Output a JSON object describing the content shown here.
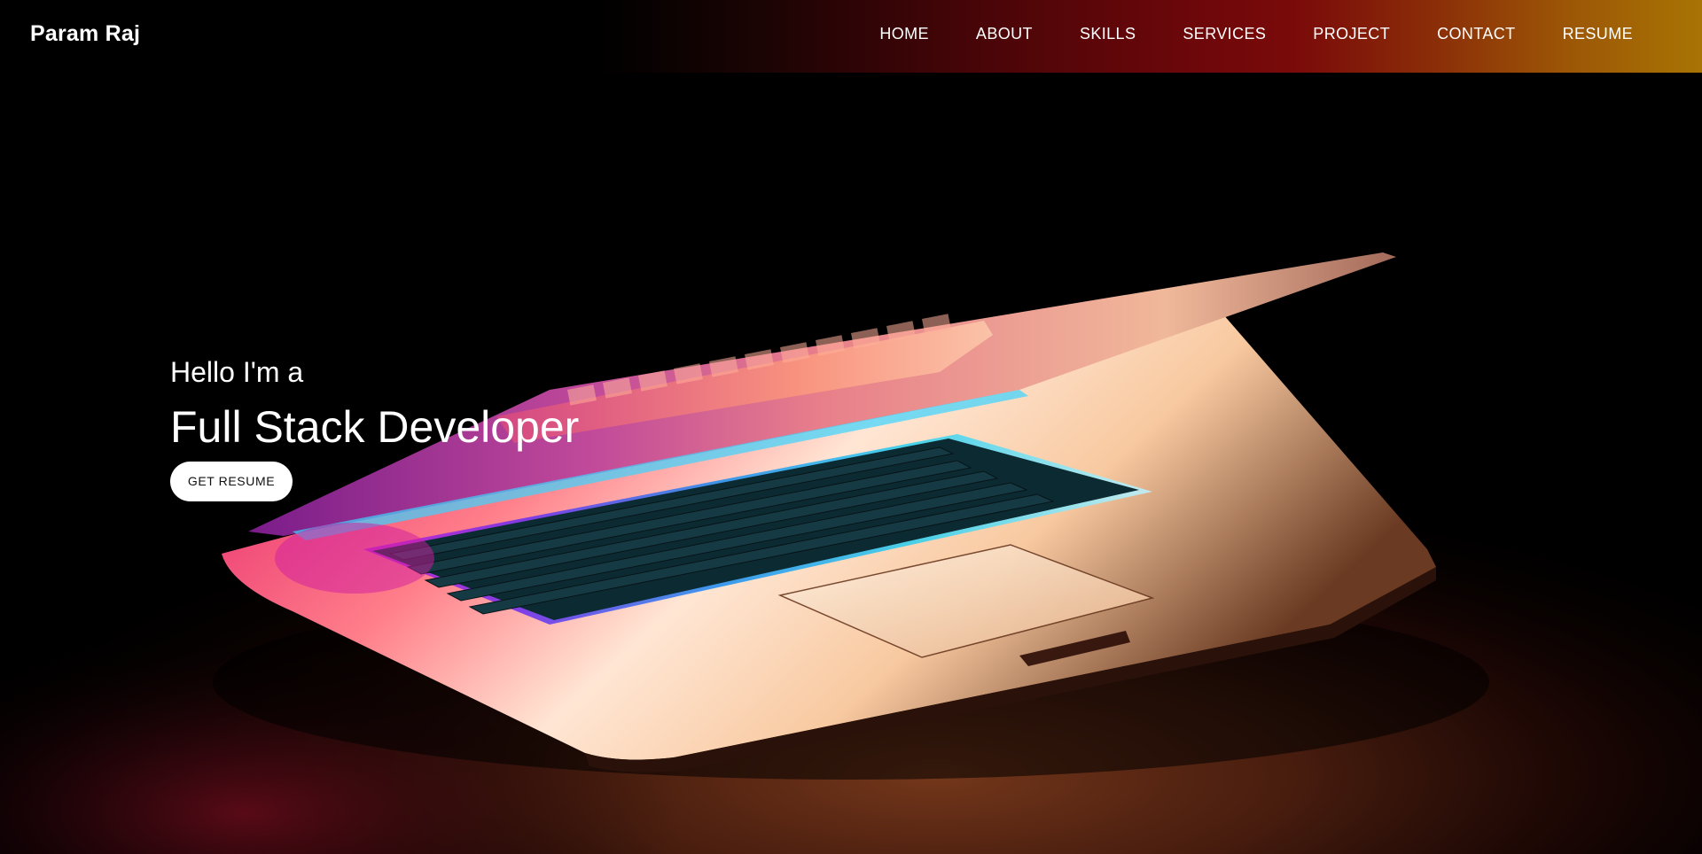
{
  "navbar": {
    "brand": "Param Raj",
    "links": [
      {
        "label": "HOME"
      },
      {
        "label": "ABOUT"
      },
      {
        "label": "SKILLS"
      },
      {
        "label": "SERVICES"
      },
      {
        "label": "PROJECT"
      },
      {
        "label": "CONTACT"
      },
      {
        "label": "RESUME"
      }
    ]
  },
  "hero": {
    "greeting": "Hello I'm a",
    "title": "Full Stack Developer",
    "cta_label": "GET RESUME",
    "image_subject": "glowing laptop on wooden desk"
  },
  "colors": {
    "nav_gradient_start": "#000000",
    "nav_gradient_mid": "#7a0a0a",
    "nav_gradient_end": "#a87404",
    "background": "#000000",
    "text": "#ffffff",
    "button_bg": "#ffffff",
    "button_text": "#111111"
  }
}
